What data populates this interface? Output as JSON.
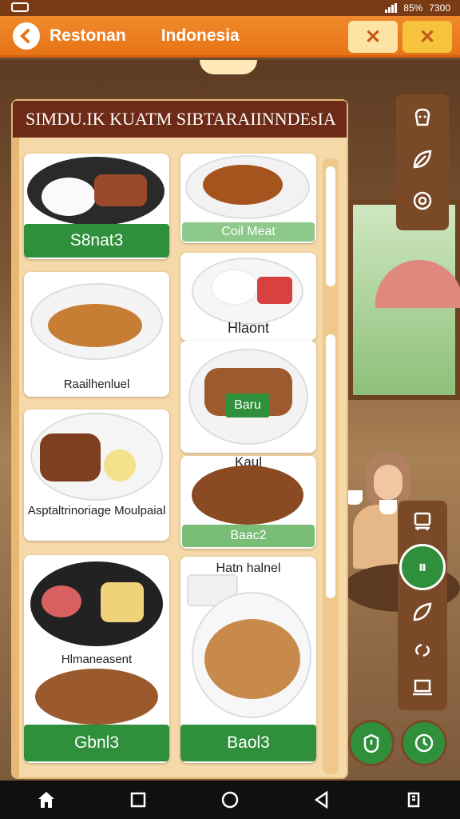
{
  "status": {
    "battery": "85%",
    "time": "7300"
  },
  "app_bar": {
    "title": "Restonan",
    "subtitle": "Indonesia"
  },
  "panel": {
    "title": "SIMDU.IK KUATM SIBTARAIINNDEsIA"
  },
  "cards": {
    "c1": {
      "button": "S8nat3"
    },
    "c2": {
      "button": "Coil Meat"
    },
    "c3": {
      "label": "Raailhenluel"
    },
    "c4": {
      "label": "Hlaont"
    },
    "c5": {
      "badge": "Baru",
      "label": "Kaul"
    },
    "c6": {
      "label": "Asptaltrinoriage Moulpaial"
    },
    "c7": {
      "button": "Baac2"
    },
    "c8": {
      "label": "Hlmaneasent",
      "button": "Gbnl3"
    },
    "c9": {
      "label": "Hatn halnel",
      "button": "Baol3"
    }
  },
  "colors": {
    "accent": "#e67417",
    "green": "#2f8f3a",
    "panel": "#f6d9a8",
    "header": "#6d2a16"
  },
  "icons": [
    "back-icon",
    "close-icon",
    "chef-hat-icon",
    "leaf-icon",
    "settings-badge-icon",
    "robot-icon",
    "split-icon",
    "leaf-small-icon",
    "link-icon",
    "laptop-icon",
    "timer-icon",
    "clock-icon",
    "home-icon",
    "square-icon",
    "circle-icon",
    "triangle-icon",
    "recents-icon"
  ]
}
